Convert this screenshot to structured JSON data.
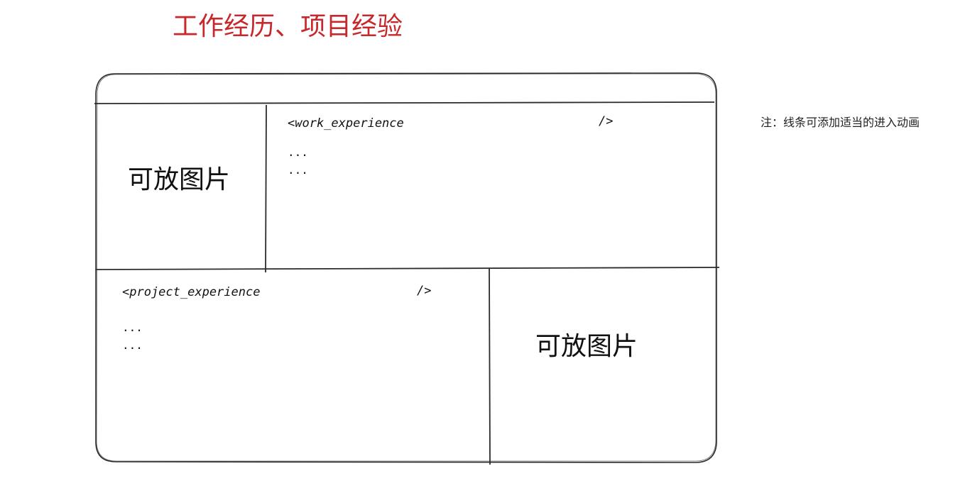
{
  "title": "工作经历、项目经验",
  "note": "注：线条可添加适当的进入动画",
  "work_panel": {
    "image_placeholder": "可放图片",
    "open_tag": "<work_experience",
    "close_tag": "/>",
    "lines": [
      "...",
      "..."
    ]
  },
  "project_panel": {
    "open_tag": "<project_experience",
    "close_tag": "/>",
    "lines": [
      "...",
      "..."
    ],
    "image_placeholder": "可放图片"
  },
  "colors": {
    "title": "#c8282b",
    "stroke": "#2b2b2b"
  }
}
